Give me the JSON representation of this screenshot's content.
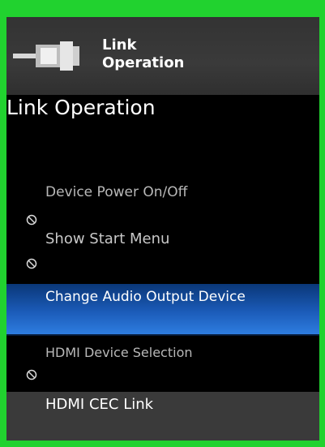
{
  "header": {
    "title_line1": "Link",
    "title_line2": "Operation"
  },
  "page": {
    "title": "Link Operation"
  },
  "menu": {
    "items": [
      {
        "label": "Device Power On/Off",
        "state": "disabled",
        "icon": "disabled-icon"
      },
      {
        "label": "Show Start Menu",
        "state": "disabled",
        "icon": "disabled-icon"
      },
      {
        "label": "Change Audio Output Device",
        "state": "selected"
      },
      {
        "label": "HDMI Device Selection",
        "state": "disabled",
        "icon": "disabled-icon"
      },
      {
        "label": "HDMI CEC Link",
        "state": "normal"
      }
    ]
  },
  "colors": {
    "border": "#21d22f",
    "selected_bg": "#1b5bb8",
    "footer_bg": "#3a3a3a"
  }
}
